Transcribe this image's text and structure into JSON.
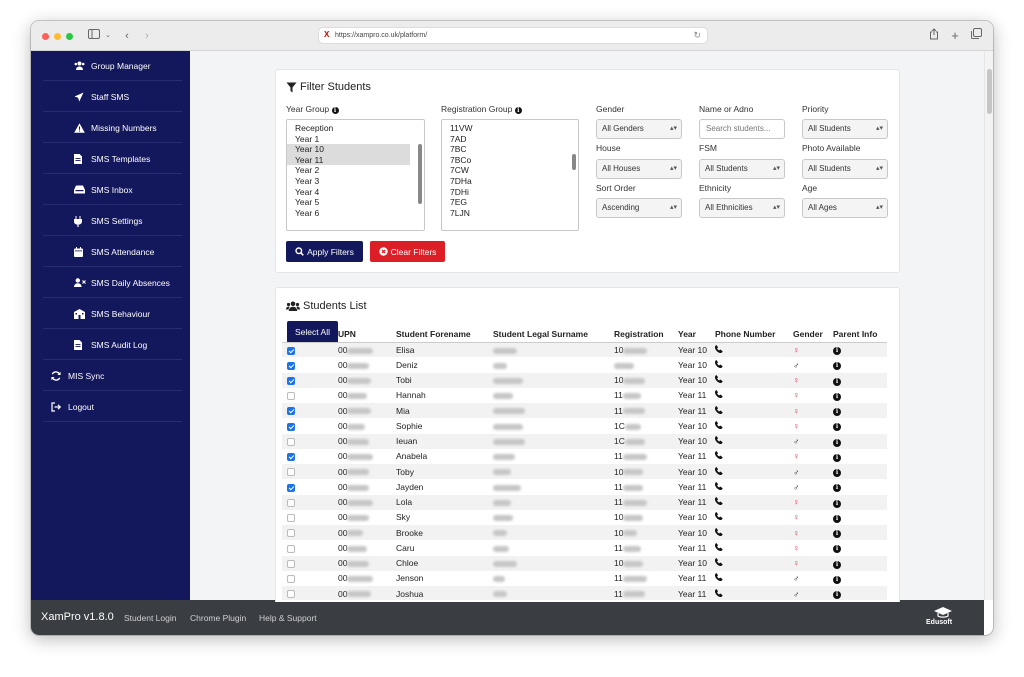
{
  "browser": {
    "url": "https://xampro.co.uk/platform/"
  },
  "sidebar": {
    "items": [
      {
        "label": "Group Manager",
        "icon": "users-icon",
        "sub": true
      },
      {
        "label": "Staff SMS",
        "icon": "paper-plane-icon",
        "sub": true
      },
      {
        "label": "Missing Numbers",
        "icon": "warning-icon",
        "sub": true
      },
      {
        "label": "SMS Templates",
        "icon": "document-icon",
        "sub": true
      },
      {
        "label": "SMS Inbox",
        "icon": "inbox-icon",
        "sub": true
      },
      {
        "label": "SMS Settings",
        "icon": "plug-icon",
        "sub": true
      },
      {
        "label": "SMS Attendance",
        "icon": "calendar-icon",
        "sub": true
      },
      {
        "label": "SMS Daily Absences",
        "icon": "user-x-icon",
        "sub": true
      },
      {
        "label": "SMS Behaviour",
        "icon": "building-icon",
        "sub": true
      },
      {
        "label": "SMS Audit Log",
        "icon": "document-icon",
        "sub": true
      },
      {
        "label": "MIS Sync",
        "icon": "sync-icon",
        "sub": false
      },
      {
        "label": "Logout",
        "icon": "logout-icon",
        "sub": false
      }
    ]
  },
  "filter": {
    "title": "Filter Students",
    "year_group_label": "Year Group",
    "year_group_options": [
      "Reception",
      "Year 1",
      "Year 10",
      "Year 11",
      "Year 2",
      "Year 3",
      "Year 4",
      "Year 5",
      "Year 6"
    ],
    "reg_group_label": "Registration Group",
    "reg_group_options": [
      "11VW",
      "7AD",
      "7BC",
      "7BCo",
      "7CW",
      "7DHa",
      "7DHi",
      "7EG",
      "7LJN"
    ],
    "gender_label": "Gender",
    "gender_value": "All Genders",
    "name_label": "Name or Adno",
    "name_placeholder": "Search students...",
    "priority_label": "Priority",
    "priority_value": "All Students",
    "house_label": "House",
    "house_value": "All Houses",
    "fsm_label": "FSM",
    "fsm_value": "All Students",
    "photo_label": "Photo Available",
    "photo_value": "All Students",
    "sort_label": "Sort Order",
    "sort_value": "Ascending",
    "ethnicity_label": "Ethnicity",
    "ethnicity_value": "All Ethnicities",
    "age_label": "Age",
    "age_value": "All Ages",
    "apply_label": "Apply Filters",
    "clear_label": "Clear Filters"
  },
  "students": {
    "title": "Students List",
    "select_all_label": "Select All",
    "columns": [
      "UPN",
      "Student Forename",
      "Student Legal Surname",
      "Registration",
      "Year",
      "Phone Number",
      "Gender",
      "Parent Info"
    ],
    "upn_prefix": "00",
    "rows": [
      {
        "forename": "Elisa",
        "reg_prefix": "10",
        "year": "Year 10",
        "gender": "female",
        "checked": true
      },
      {
        "forename": "Deniz",
        "reg_prefix": "",
        "year": "Year 10",
        "gender": "male",
        "checked": true
      },
      {
        "forename": "Tobi",
        "reg_prefix": "10",
        "year": "Year 10",
        "gender": "female",
        "checked": true
      },
      {
        "forename": "Hannah",
        "reg_prefix": "11",
        "year": "Year 11",
        "gender": "female",
        "checked": false
      },
      {
        "forename": "Mia",
        "reg_prefix": "11",
        "year": "Year 11",
        "gender": "female",
        "checked": true
      },
      {
        "forename": "Sophie",
        "reg_prefix": "1C",
        "year": "Year 10",
        "gender": "female",
        "checked": true
      },
      {
        "forename": "Ieuan",
        "reg_prefix": "1C",
        "year": "Year 10",
        "gender": "male",
        "checked": false
      },
      {
        "forename": "Anabela",
        "reg_prefix": "11",
        "year": "Year 11",
        "gender": "female",
        "checked": true
      },
      {
        "forename": "Toby",
        "reg_prefix": "10",
        "year": "Year 10",
        "gender": "male",
        "checked": false
      },
      {
        "forename": "Jayden",
        "reg_prefix": "11",
        "year": "Year 11",
        "gender": "male",
        "checked": true
      },
      {
        "forename": "Lola",
        "reg_prefix": "11",
        "year": "Year 11",
        "gender": "female",
        "checked": false
      },
      {
        "forename": "Sky",
        "reg_prefix": "10",
        "year": "Year 10",
        "gender": "female",
        "checked": false
      },
      {
        "forename": "Brooke",
        "reg_prefix": "10",
        "year": "Year 10",
        "gender": "female",
        "checked": false
      },
      {
        "forename": "Caru",
        "reg_prefix": "11",
        "year": "Year 11",
        "gender": "female",
        "checked": false
      },
      {
        "forename": "Chloe",
        "reg_prefix": "10",
        "year": "Year 10",
        "gender": "female",
        "checked": false
      },
      {
        "forename": "Jenson",
        "reg_prefix": "11",
        "year": "Year 11",
        "gender": "male",
        "checked": false
      },
      {
        "forename": "Joshua",
        "reg_prefix": "11",
        "year": "Year 11",
        "gender": "male",
        "checked": false
      }
    ]
  },
  "footer": {
    "brand": "XamPro v1.8.0",
    "links": [
      "Student Login",
      "Chrome Plugin",
      "Help & Support"
    ],
    "logo_text": "Edusoft"
  },
  "colors": {
    "navy": "#13175c",
    "danger": "#dc1f26",
    "checkbox": "#1a73e8",
    "female": "#e01e2e"
  }
}
